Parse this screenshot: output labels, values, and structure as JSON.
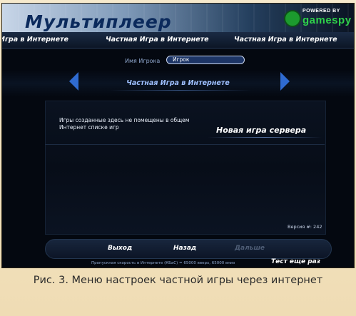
{
  "header": {
    "title": "Мультиплеер",
    "powered_by": "POWERED BY",
    "brand": "gamespy",
    "colors": {
      "title": "#0b2a5c",
      "brand": "#2fd14a"
    }
  },
  "tabs": [
    {
      "label": "Игра в Интернете"
    },
    {
      "label": "Частная Игра в Интернете"
    },
    {
      "label": "Частная Игра в Интернете"
    }
  ],
  "player": {
    "label": "Имя Игрока",
    "value": "Игрок"
  },
  "mode_selector": {
    "label": "Частная Игра в Интернете",
    "prev_icon": "arrow-left-icon",
    "next_icon": "arrow-right-icon",
    "accent": "#2f6bd1"
  },
  "info": {
    "text": "Игры созданные здесь не помещены в общем Интернет списке игр",
    "new_server_label": "Новая игра сервера",
    "version": "Версия #: 242"
  },
  "nav": {
    "exit_label": "Выход",
    "back_label": "Назад",
    "next_label": "Дальше",
    "speed_text": "Пропускная скорость в Интернете (КБаС) = 65000 вверх, 65000 вниз",
    "test_again_label": "Тест еще раз"
  },
  "caption": {
    "text": "Рис. 3. Меню настроек частной игры через интернет"
  }
}
